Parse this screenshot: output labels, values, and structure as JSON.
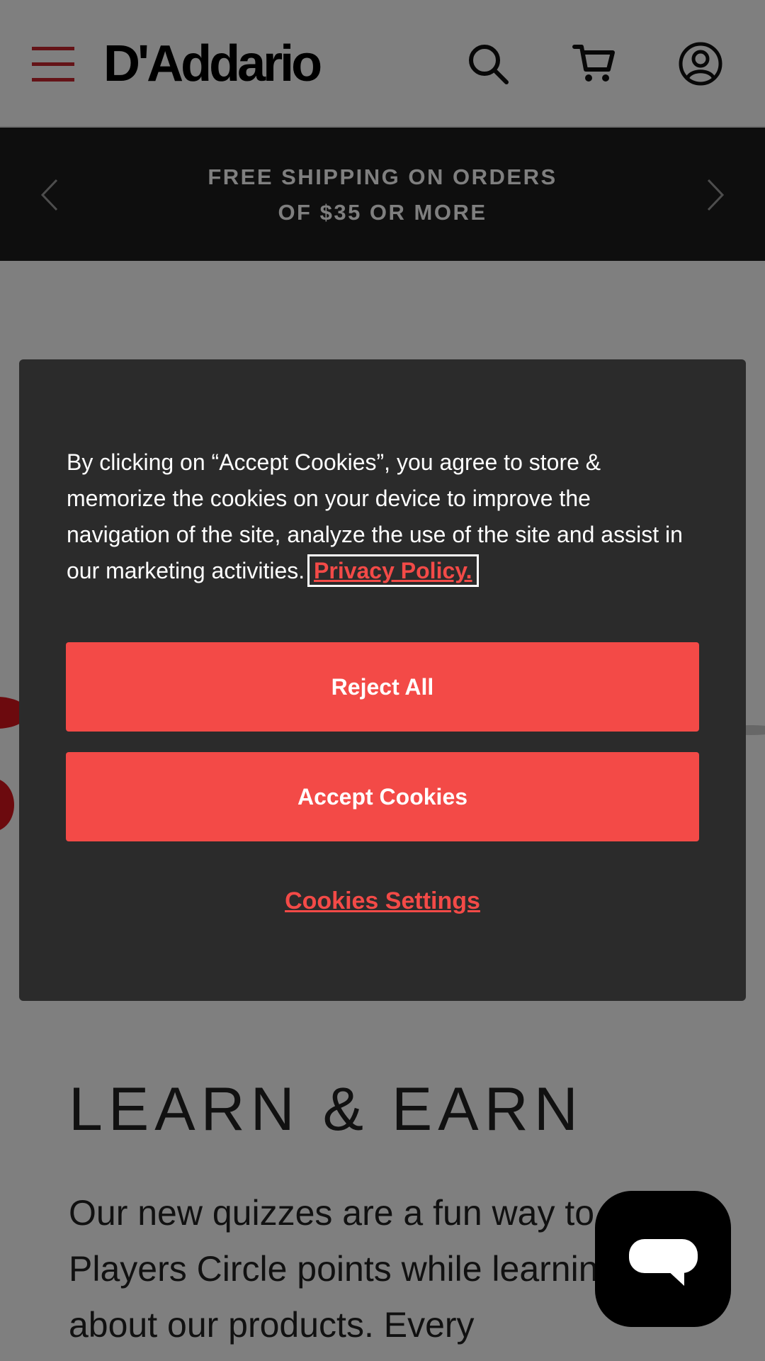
{
  "header": {
    "logo_text": "D'Addario",
    "menu_icon": "hamburger-menu-icon",
    "search_icon": "search-icon",
    "cart_icon": "cart-icon",
    "account_icon": "account-icon",
    "accent_color": "#c8262e"
  },
  "promo": {
    "line1": "FREE SHIPPING ON ORDERS",
    "line2": "OF $35 OR MORE",
    "prev_icon": "chevron-left-icon",
    "next_icon": "chevron-right-icon"
  },
  "cookie_banner": {
    "message": "By clicking on “Accept Cookies”, you agree to store & memorize the cookies on your device to improve the navigation of the site, analyze the use of the site and assist in our marketing activities.",
    "privacy_link": "Privacy Policy.",
    "reject_label": "Reject All",
    "accept_label": "Accept Cookies",
    "settings_label": "Cookies Settings",
    "button_color": "#f34a47",
    "background_color": "#2b2b2b"
  },
  "content": {
    "title": "LEARN & EARN",
    "body": "Our new quizzes are a fun way to earn Players Circle points while learning about our products. Every"
  },
  "chat_widget": {
    "icon": "chat-bubble-icon"
  }
}
